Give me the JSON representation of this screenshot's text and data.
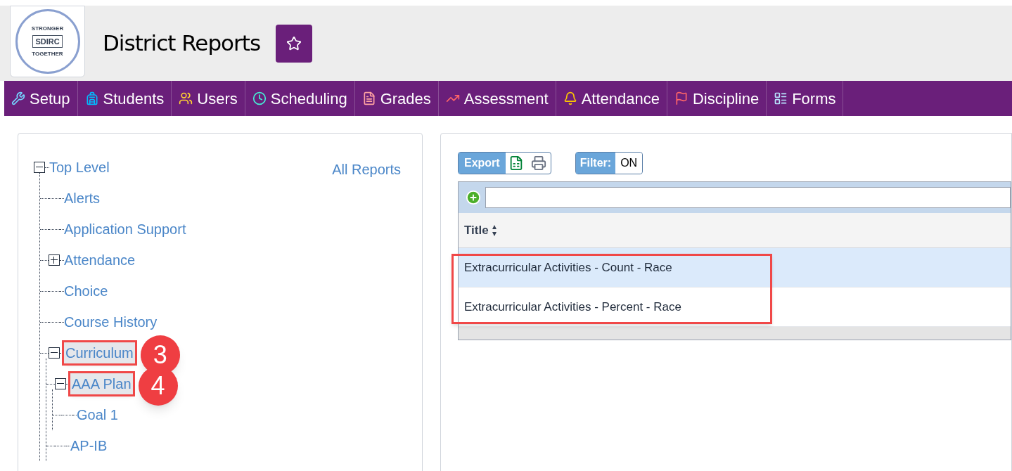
{
  "header": {
    "logo_top": "STRONGER",
    "logo_mid": "SDIRC",
    "logo_bottom": "TOGETHER",
    "title": "District Reports",
    "favorite": false
  },
  "nav": [
    {
      "label": "Setup"
    },
    {
      "label": "Students"
    },
    {
      "label": "Users"
    },
    {
      "label": "Scheduling"
    },
    {
      "label": "Grades"
    },
    {
      "label": "Assessment"
    },
    {
      "label": "Attendance"
    },
    {
      "label": "Discipline"
    },
    {
      "label": "Forms"
    }
  ],
  "tree": {
    "all_reports": "All Reports",
    "nodes": [
      {
        "label": "Top Level",
        "expanded": true,
        "highlighted": false,
        "children": [
          {
            "label": "Alerts",
            "highlighted": false
          },
          {
            "label": "Application Support",
            "highlighted": false
          },
          {
            "label": "Attendance",
            "expanded": false,
            "highlighted": false
          },
          {
            "label": "Choice",
            "highlighted": false
          },
          {
            "label": "Course History",
            "highlighted": false
          },
          {
            "label": "Curriculum",
            "expanded": true,
            "highlighted": true,
            "callout": "3",
            "children": [
              {
                "label": "AAA Plan",
                "expanded": true,
                "highlighted": true,
                "callout": "4",
                "children": [
                  {
                    "label": "Goal 1",
                    "highlighted": false
                  }
                ]
              },
              {
                "label": "AP-IB",
                "highlighted": false
              }
            ]
          }
        ]
      }
    ]
  },
  "toolbar": {
    "export": "Export",
    "filter_label": "Filter:",
    "filter_value": "ON"
  },
  "table": {
    "columns": [
      "Title"
    ],
    "annotated": true,
    "rows": [
      {
        "title": "Extracurricular Activities - Count - Race",
        "selected": true
      },
      {
        "title": "Extracurricular Activities - Percent - Race",
        "selected": false
      }
    ]
  }
}
